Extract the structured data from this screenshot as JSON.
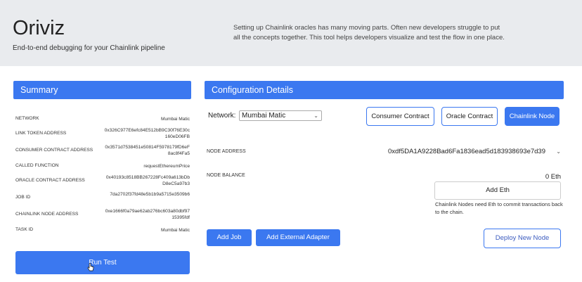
{
  "header": {
    "title": "Oriviz",
    "subtitle": "End-to-end debugging for your Chainlink pipeline",
    "intro_line1": "Setting up Chainlink oracles has many moving parts. Often new developers struggle to put",
    "intro_line2": "all the concepts together. This tool helps developers visualize and test the flow in one place."
  },
  "summary": {
    "heading": "Summary",
    "rows": [
      {
        "key": "NETWORK",
        "value": "Mumbai Matic"
      },
      {
        "key": "LINK TOKEN ADDRESS",
        "value": "0x326C977E6efc84E512bB9C30f76E30c160eD06FB"
      },
      {
        "key": "CONSUMER CONTRACT ADDRESS",
        "value": "0x3571d7538451e50814F5978179fD6eF8ac8f4Fa5"
      },
      {
        "key": "CALLED FUNCTION",
        "value": "requestEthereumPrice"
      },
      {
        "key": "ORACLE CONTRACT ADDRESS",
        "value": "0x40193c8518BB267228Fc409a613bDbD8eC5a97b3"
      },
      {
        "key": "JOB ID",
        "value": "7da2702f37fd48e5b1b9a5715e3509b6"
      },
      {
        "key": "CHAINLINK NODE ADDRESS",
        "value": "0xe1666f0a79ae62ab276bc603a80dbf9715395fdf"
      },
      {
        "key": "TASK ID",
        "value": "Mumbai Matic"
      }
    ],
    "run_label": "Run Test"
  },
  "config": {
    "heading": "Configuration Details",
    "network_label": "Network:",
    "network_value": "Mumbai Matic",
    "tabs": [
      "Consumer Contract",
      "Oracle Contract",
      "Chainlink Node"
    ],
    "active_tab": "Chainlink Node",
    "node_address_label": "NODE ADDRESS",
    "node_address_value": "0xdf5DA1A9228Bad6Fa1836ead5d183938693e7d39",
    "node_balance_label": "NODE BALANCE",
    "node_balance_value": "0 Eth",
    "add_eth_label": "Add Eth",
    "eth_note": "Chainlink Nodes need Eth to commit transactions back to the chain.",
    "add_job_label": "Add Job",
    "add_adapter_label": "Add External Adapter",
    "deploy_label": "Deploy New Node"
  },
  "colors": {
    "accent": "#3b78f0",
    "header_bg": "#e9ebee"
  },
  "icons": {
    "select_chevron": "chevron-down-icon",
    "cursor": "hand-pointer-icon"
  }
}
